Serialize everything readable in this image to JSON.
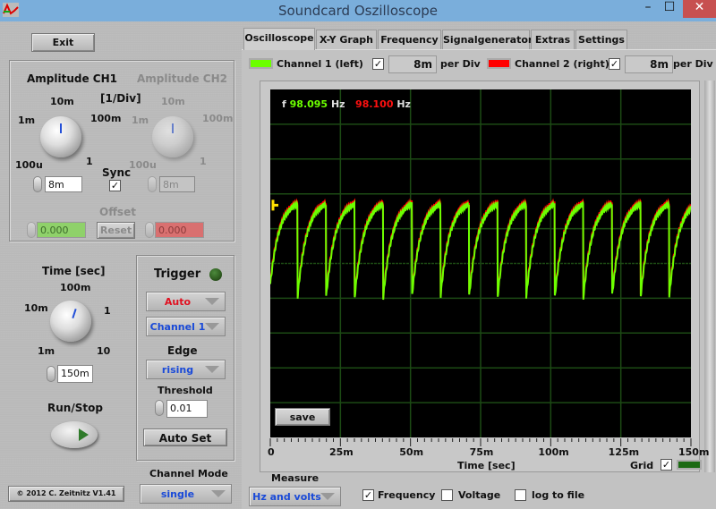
{
  "window": {
    "title": "Soundcard Oszilloscope",
    "minimize_glyph": "–",
    "maximize_glyph": "☐",
    "close_glyph": "✕"
  },
  "left": {
    "exit_label": "Exit",
    "amplitude": {
      "ch1_title": "Amplitude CH1",
      "ch2_title": "Amplitude CH2",
      "unit_label": "[1/Div]",
      "scale_labels": [
        "100u",
        "1m",
        "10m",
        "100m",
        "1"
      ],
      "ch1_value": "8m",
      "ch2_value": "8m",
      "sync_label": "Sync",
      "sync_checked": true,
      "offset_label": "Offset",
      "offset_ch1": "0.000",
      "offset_ch2": "0.000",
      "reset_label": "Reset",
      "ch1_color": "#8fd16a",
      "ch2_color": "#d97070"
    },
    "time": {
      "title": "Time [sec]",
      "scale_labels": [
        "1m",
        "10m",
        "100m",
        "1",
        "10"
      ],
      "value": "150m"
    },
    "run_stop_label": "Run/Stop",
    "trigger": {
      "title": "Trigger",
      "mode": "Auto",
      "source": "Channel 1",
      "edge_label": "Edge",
      "edge": "rising",
      "threshold_label": "Threshold",
      "threshold": "0.01",
      "auto_set_label": "Auto Set",
      "led_color": "#2d5a1e"
    },
    "channel_mode_label": "Channel Mode",
    "channel_mode": "single",
    "copyright": "© 2012  C. Zeitnitz V1.41"
  },
  "tabs": [
    {
      "label": "Oscilloscope",
      "active": true
    },
    {
      "label": "X-Y Graph",
      "active": false
    },
    {
      "label": "Frequency",
      "active": false
    },
    {
      "label": "Signalgenerator",
      "active": false
    },
    {
      "label": "Extras",
      "active": false
    },
    {
      "label": "Settings",
      "active": false
    }
  ],
  "channels": {
    "ch1_label": "Channel 1 (left)",
    "ch1_color": "#6cff00",
    "ch1_enabled": true,
    "ch1_perdiv": "8m",
    "ch2_label": "Channel 2 (right)",
    "ch2_color": "#ff0000",
    "ch2_enabled": true,
    "ch2_perdiv": "8m",
    "perdiv_label": "per Div"
  },
  "plot": {
    "freq_prefix": "f",
    "freq_ch1": "98.095",
    "freq_ch2": "98.100",
    "freq_unit": "Hz",
    "save_label": "save",
    "xlabel": "Time [sec]",
    "x_ticks": [
      "0",
      "25m",
      "50m",
      "75m",
      "100m",
      "125m",
      "150m"
    ],
    "grid_label": "Grid",
    "grid_checked": true,
    "grid_color": "#1c4a14"
  },
  "measure": {
    "label": "Measure",
    "mode": "Hz and volts",
    "frequency_label": "Frequency",
    "frequency_checked": true,
    "voltage_label": "Voltage",
    "voltage_checked": false,
    "log_label": "log to file",
    "log_checked": false
  },
  "chart_data": {
    "type": "line",
    "title": "",
    "xlabel": "Time [sec]",
    "ylabel": "",
    "x_ticks": [
      "0",
      "25m",
      "50m",
      "75m",
      "100m",
      "125m",
      "150m"
    ],
    "xlim": [
      0,
      0.15
    ],
    "ylim_div": [
      -5,
      5
    ],
    "grid": true,
    "series": [
      {
        "name": "Channel 1 (left)",
        "color": "#6cff00",
        "waveform": "sawtooth-exponential-rise",
        "frequency_hz": 98.095,
        "min_div": -1.0,
        "max_div": 1.7
      },
      {
        "name": "Channel 2 (right)",
        "color": "#ff0000",
        "waveform": "sawtooth-exponential-rise",
        "frequency_hz": 98.1,
        "min_div": -1.0,
        "max_div": 1.7
      }
    ]
  }
}
